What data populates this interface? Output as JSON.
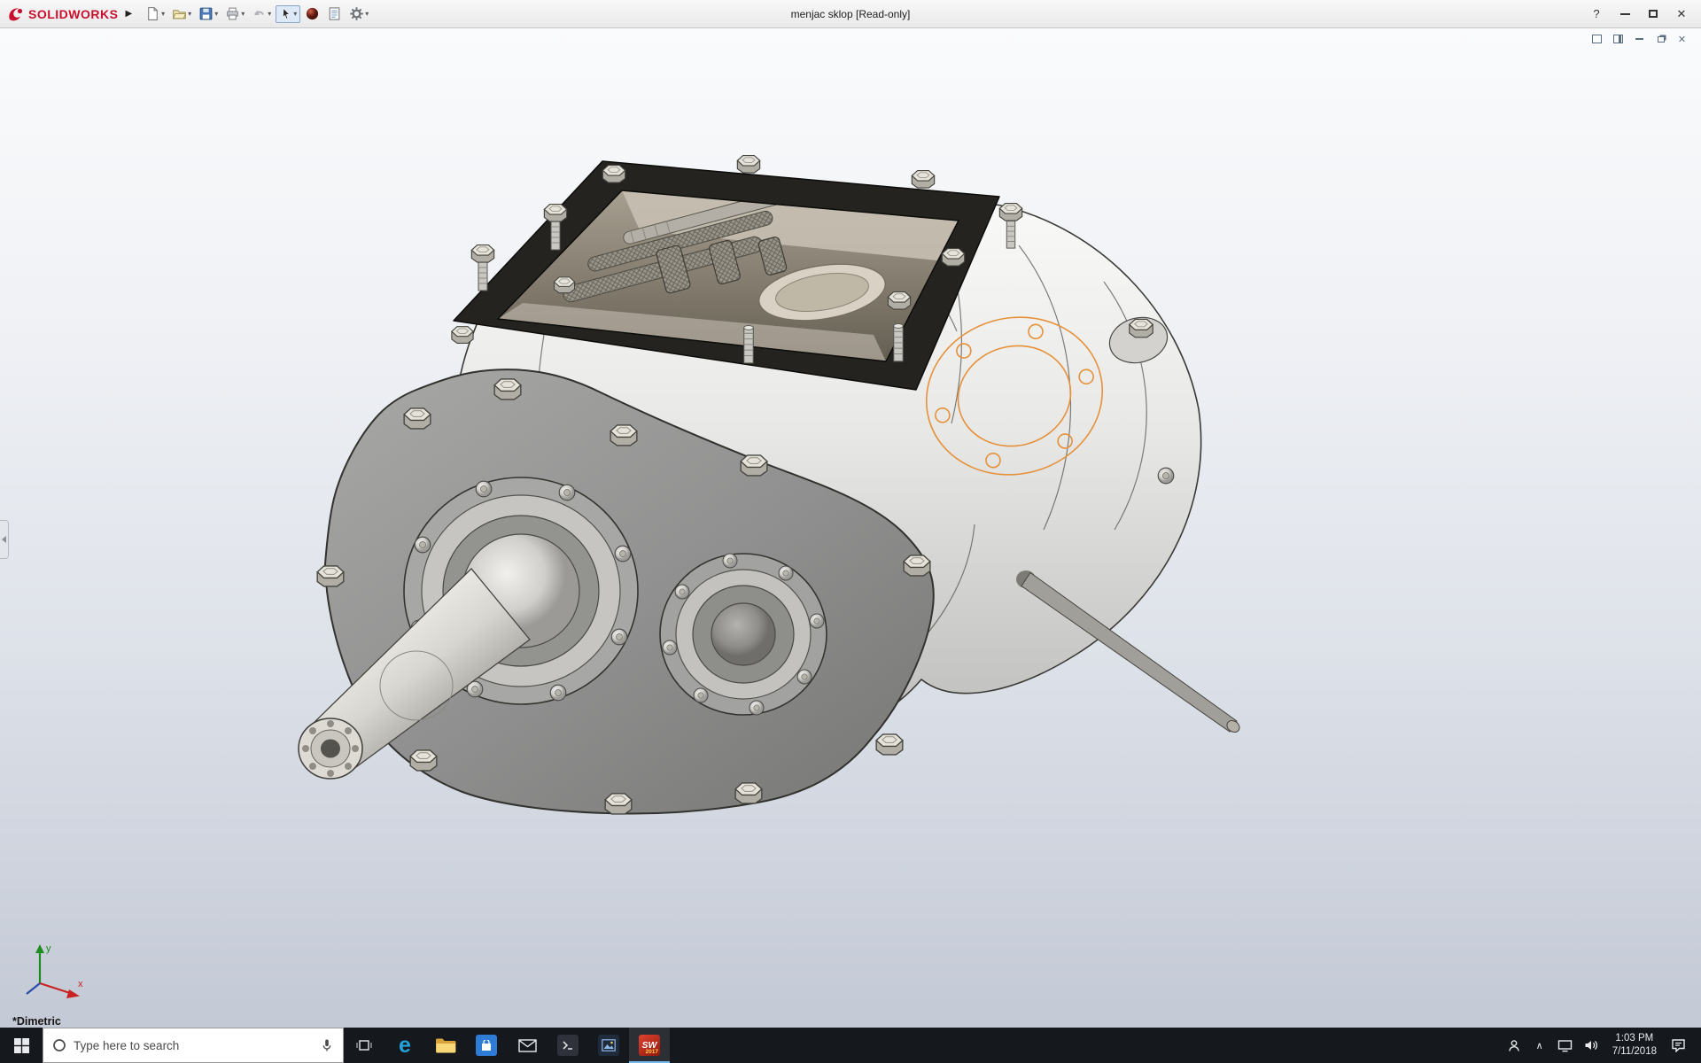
{
  "titlebar": {
    "brand": "SOLIDWORKS",
    "title": "menjac sklop [Read-only]",
    "menu_arrow": "▶",
    "help": "?",
    "close": "✕",
    "caret": "▾",
    "toolbar_icons": [
      "new-document",
      "open",
      "save",
      "print",
      "undo",
      "select-tool",
      "appearance-sphere",
      "sheet-properties",
      "options-gear"
    ]
  },
  "docwin": {
    "close": "✕",
    "controls": [
      "new-window-icon",
      "split-pane-icon",
      "minimize-icon",
      "restore-icon",
      "close-icon"
    ]
  },
  "viewport": {
    "view_name": "*Dimetric",
    "triad_x": "x",
    "triad_y": "y",
    "model_name_hint": "gearbox assembly shaded-with-edges view"
  },
  "taskbar": {
    "search_placeholder": "Type here to search",
    "chevron": "∧",
    "time": "1:03 PM",
    "date": "7/11/2018",
    "sw_label": "SW",
    "sw_year": "2017",
    "edge_glyph": "e",
    "apps": [
      "task-view",
      "edge",
      "file-explorer",
      "store",
      "mail",
      "terminal",
      "photos",
      "solidworks"
    ],
    "tray_icons": [
      "people",
      "hidden-icons-chevron",
      "network",
      "volume",
      "clock",
      "action-center"
    ]
  },
  "colors": {
    "brand_red": "#c8102e",
    "sketch_orange": "#e6913a",
    "taskbar_bg": "#15181c",
    "active_accent": "#76b9ed"
  }
}
